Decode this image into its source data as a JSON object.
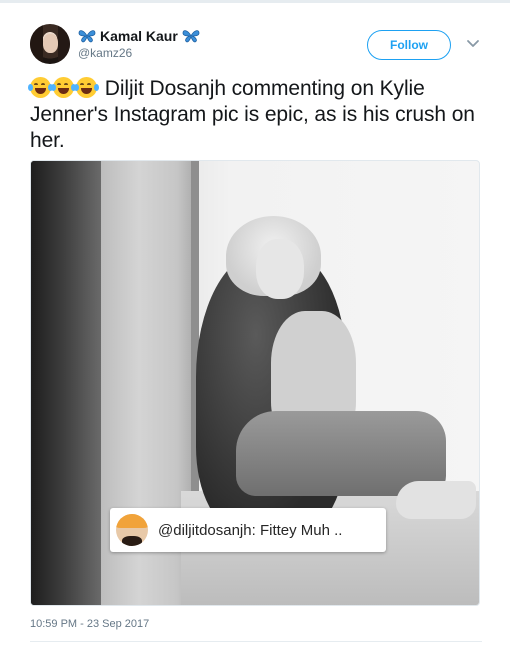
{
  "user": {
    "display_name": "Kamal Kaur",
    "handle": "@kamz26",
    "name_decoration_icon": "butterfly-emoji"
  },
  "actions": {
    "follow_label": "Follow",
    "more_icon": "chevron-down-icon"
  },
  "tweet": {
    "emoji": [
      "😂",
      "😂",
      "😂"
    ],
    "text": "Diljit Dosanjh commenting on Kylie Jenner's Instagram pic is epic, as is his crush on her."
  },
  "media": {
    "comment": "@diljitdosanjh: Fittey Muh .."
  },
  "timestamp": "10:59 PM - 23 Sep 2017",
  "colors": {
    "accent": "#1da1f2",
    "text": "#14171a",
    "secondary": "#657786"
  }
}
